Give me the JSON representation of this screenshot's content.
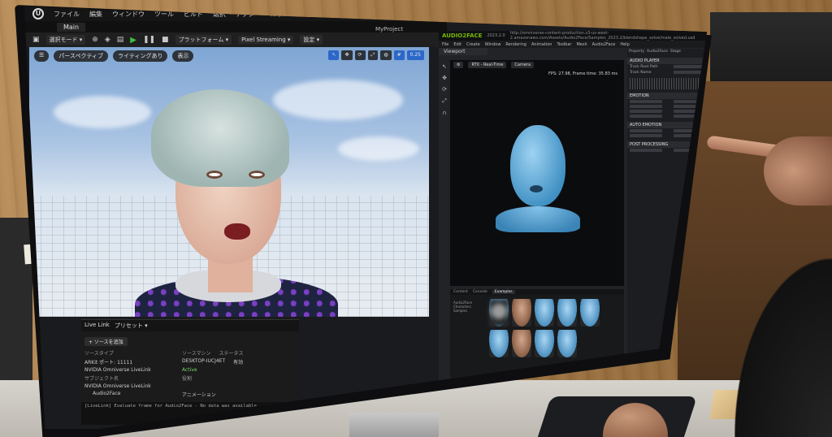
{
  "ue": {
    "logo": "U",
    "menu": [
      "ファイル",
      "編集",
      "ウィンドウ",
      "ツール",
      "ビルド",
      "選択",
      "アクタ",
      "ヘルプ"
    ],
    "tab": "Main",
    "project": "MyProject",
    "toolbar": {
      "select_mode": "選択モード ▾",
      "platform": "プラットフォーム ▾",
      "pixel_streaming": "Pixel Streaming ▾",
      "settings": "設定 ▾"
    },
    "viewport": {
      "perspective": "パースペクティブ",
      "lighting": "ライティングあり",
      "show": "表示",
      "snap_value": "0.25"
    },
    "livelink": {
      "tab_livelink": "Live Link",
      "tab_presets": "プリセット ▾",
      "add_source": "+ ソースを追加",
      "col_source_type": "ソースタイプ",
      "col_source_machine": "ソースマシン",
      "col_status": "ステータス",
      "row1_type": "ARKit ポート: 11111",
      "row1_machine": "DESKTOP-IUCJ4ET",
      "row1_status": "有効",
      "row2_type": "NVIDIA Omniverse LiveLink",
      "row2_status": "Active",
      "subject_name": "サブジェクト名",
      "role": "役割",
      "subject_group": "NVIDIA Omniverse LiveLink",
      "subject_item": "Audio2Face",
      "animation": "アニメーション",
      "console": "[LiveLink] Evaluate frame for Audio2Face - No data was available"
    }
  },
  "a2f": {
    "logo": "AUDIO2FACE",
    "version": "2023.2.0",
    "path": "http://omniverse-content-production.s3-us-west-2.amazonaws.com/Assets/Audio2Face/Samples_2023.2/blendshape_solve/male_solved.usd",
    "menu": [
      "File",
      "Edit",
      "Create",
      "Window",
      "Rendering",
      "Animation",
      "Toolbar",
      "Mesh",
      "Audio2Face",
      "Help"
    ],
    "viewport_tab": "Viewport",
    "rtx_mode": "RTX - Real-Time",
    "camera": "Camera",
    "fps": "FPS: 27.98, Frame time: 35.83 ms",
    "props_tabs": [
      "Property",
      "Audio2Face",
      "Stage"
    ],
    "section_audio": "AUDIO PLAYER",
    "track_root": "Track Root Path",
    "track_name": "Track Name",
    "section_emotion": "EMOTION",
    "section_post": "POST PROCESSING",
    "section_auto": "AUTO EMOTION",
    "bottom_tabs": [
      "Content",
      "Console",
      "Examples"
    ],
    "tree": [
      "Audio2Face",
      "Characters",
      "Samples"
    ]
  }
}
